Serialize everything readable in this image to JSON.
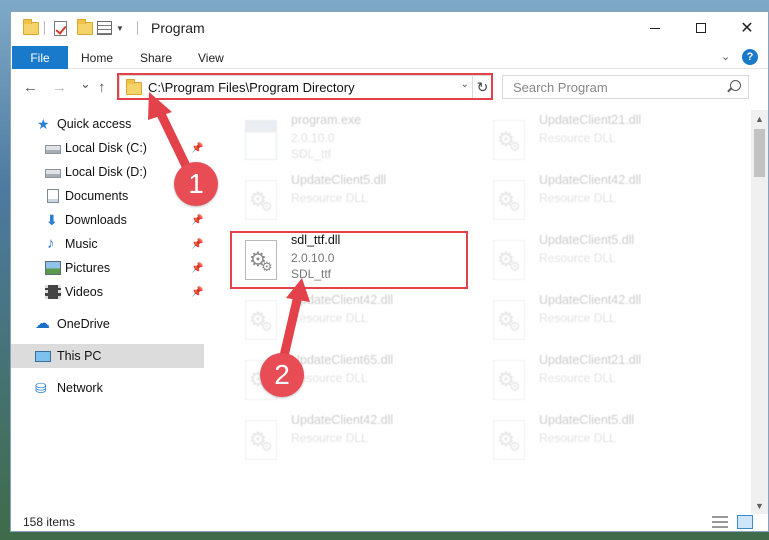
{
  "window": {
    "title": "Program",
    "controls": {
      "minimize": "",
      "maximize": "",
      "close": "✕"
    }
  },
  "ribbon": {
    "tabs": [
      "File",
      "Home",
      "Share",
      "View"
    ],
    "expand_icon": "chevron-down-icon",
    "help": "?"
  },
  "nav": {
    "back": "←",
    "forward": "→",
    "recent": "⌄",
    "up": "↑",
    "address": "C:\\Program Files\\Program Directory",
    "refresh": "↻",
    "search_placeholder": "Search Program"
  },
  "sidebar": {
    "items": [
      {
        "label": "Quick access",
        "icon": "star-icon",
        "pinned": false
      },
      {
        "label": "Local Disk (C:)",
        "icon": "disk-icon",
        "pinned": true
      },
      {
        "label": "Local Disk (D:)",
        "icon": "disk-icon",
        "pinned": false
      },
      {
        "label": "Documents",
        "icon": "documents-icon",
        "pinned": true
      },
      {
        "label": "Downloads",
        "icon": "downloads-icon",
        "pinned": true
      },
      {
        "label": "Music",
        "icon": "music-icon",
        "pinned": true
      },
      {
        "label": "Pictures",
        "icon": "pictures-icon",
        "pinned": true
      },
      {
        "label": "Videos",
        "icon": "videos-icon",
        "pinned": true
      },
      {
        "label": "OneDrive",
        "icon": "onedrive-icon",
        "pinned": false
      },
      {
        "label": "This PC",
        "icon": "this-pc-icon",
        "pinned": false,
        "selected": true
      },
      {
        "label": "Network",
        "icon": "network-icon",
        "pinned": false
      }
    ]
  },
  "files": {
    "left": [
      {
        "name": "program.exe",
        "line1": "2.0.10.0",
        "line2": "SDL_ttf"
      },
      {
        "name": "UpdateClient5.dll",
        "line1": "Resource DLL",
        "line2": ""
      },
      {
        "name": "sdl_ttf.dll",
        "line1": "2.0.10.0",
        "line2": "SDL_ttf"
      },
      {
        "name": "UpdateClient42.dll",
        "line1": "Resource DLL",
        "line2": ""
      },
      {
        "name": "UpdateClient65.dll",
        "line1": "Resource DLL",
        "line2": ""
      },
      {
        "name": "UpdateClient42.dll",
        "line1": "Resource DLL",
        "line2": ""
      }
    ],
    "right": [
      {
        "name": "UpdateClient21.dll",
        "line1": "Resource DLL",
        "line2": ""
      },
      {
        "name": "UpdateClient42.dll",
        "line1": "Resource DLL",
        "line2": ""
      },
      {
        "name": "UpdateClient5.dll",
        "line1": "Resource DLL",
        "line2": ""
      },
      {
        "name": "UpdateClient42.dll",
        "line1": "Resource DLL",
        "line2": ""
      },
      {
        "name": "UpdateClient21.dll",
        "line1": "Resource DLL",
        "line2": ""
      },
      {
        "name": "UpdateClient5.dll",
        "line1": "Resource DLL",
        "line2": ""
      }
    ]
  },
  "status": {
    "count": "158 items"
  },
  "annotations": {
    "callout_1": "1",
    "callout_2": "2",
    "color": "#e3424a"
  }
}
